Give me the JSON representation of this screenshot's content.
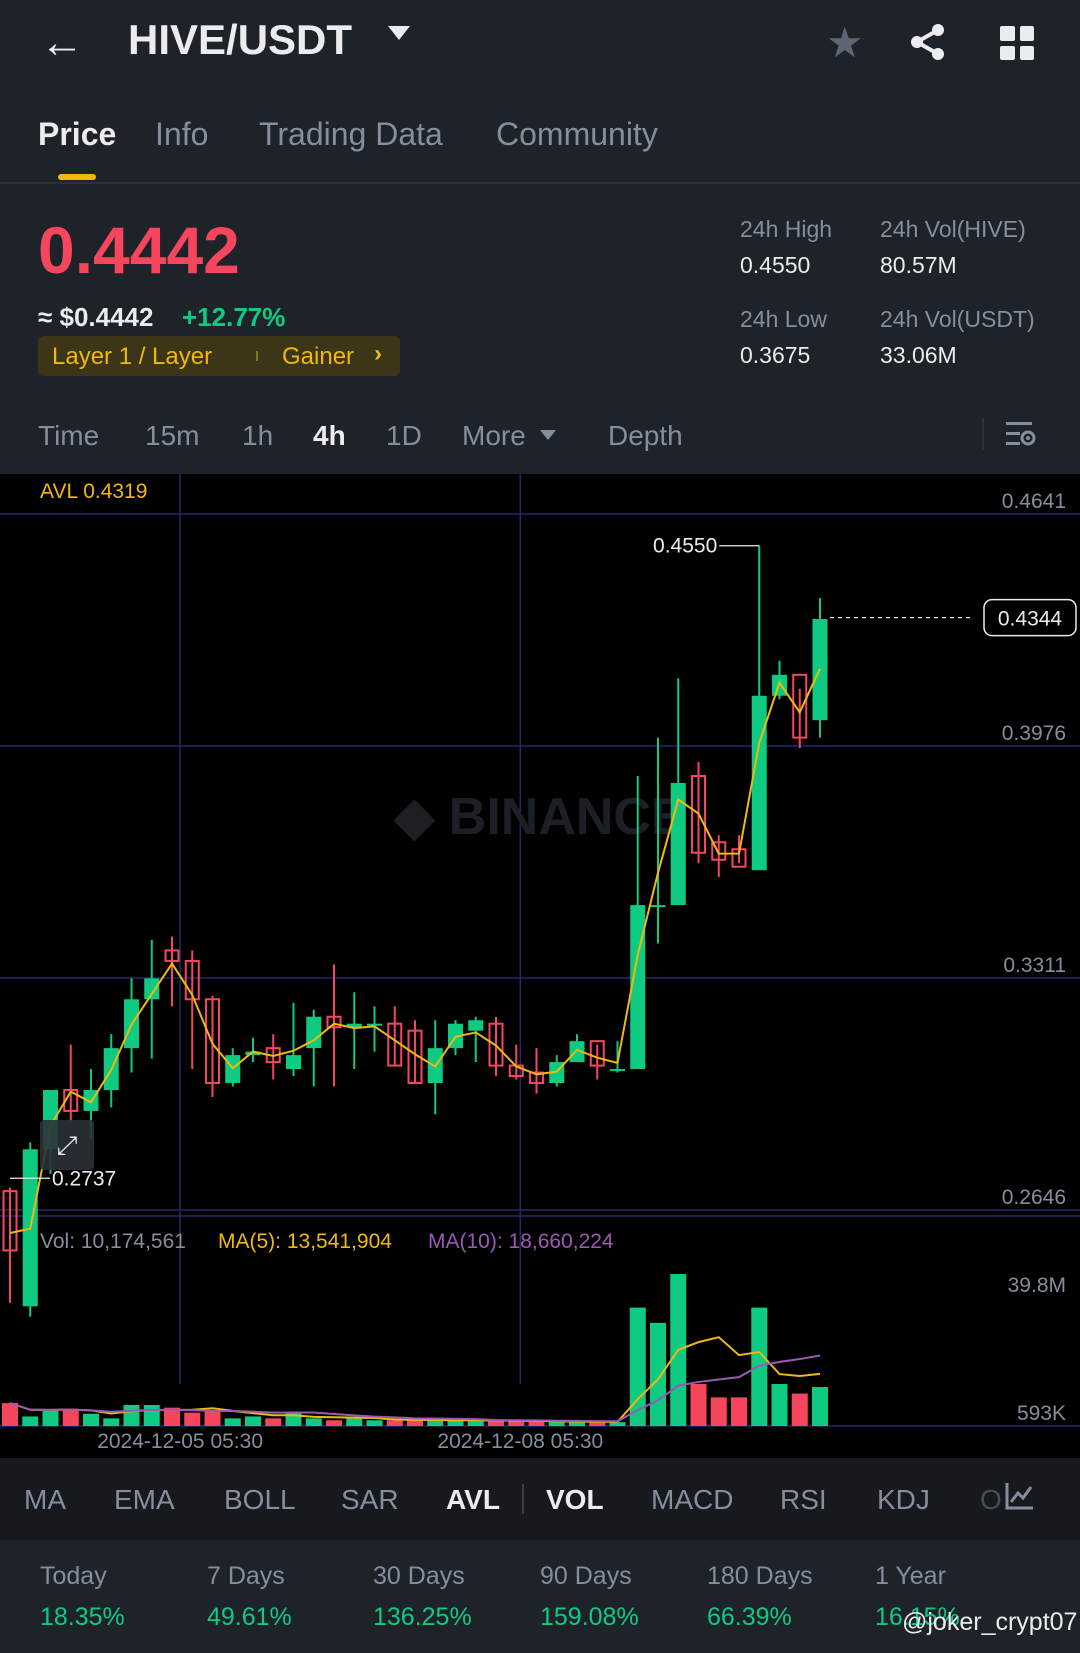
{
  "header": {
    "pair": "HIVE/USDT",
    "back_icon": "arrow-left-icon",
    "star_icon": "star-icon",
    "share_icon": "share-icon",
    "grid_icon": "grid-icon"
  },
  "tabs": [
    {
      "label": "Price",
      "active": true
    },
    {
      "label": "Info"
    },
    {
      "label": "Trading Data"
    },
    {
      "label": "Community"
    }
  ],
  "price": {
    "last": "0.4442",
    "usd": "≈ $0.4442",
    "change": "+12.77%",
    "tag_sector": "Layer 1 / Layer",
    "tag_status": "Gainer",
    "color_down": "#f6465d",
    "color_up": "#0ecb81",
    "accent": "#f0b90b"
  },
  "stats": {
    "high_label": "24h High",
    "high_value": "0.4550",
    "low_label": "24h Low",
    "low_value": "0.3675",
    "vol_base_label": "24h Vol(HIVE)",
    "vol_base_value": "80.57M",
    "vol_quote_label": "24h Vol(USDT)",
    "vol_quote_value": "33.06M"
  },
  "intervals": [
    {
      "label": "Time"
    },
    {
      "label": "15m"
    },
    {
      "label": "1h"
    },
    {
      "label": "4h",
      "active": true
    },
    {
      "label": "1D"
    },
    {
      "label": "More"
    },
    {
      "label": "Depth"
    }
  ],
  "chart_data": {
    "type": "candlestick",
    "avl_label": "AVL 0.4319",
    "y_ticks": [
      "0.4641",
      "0.3976",
      "0.3311",
      "0.2646"
    ],
    "ylim": [
      0.2646,
      0.4641
    ],
    "current_price": "0.4344",
    "high_marker": "0.4550",
    "low_marker": "0.2737",
    "x_labels": [
      "2024-12-05 05:30",
      "2024-12-08 05:30"
    ],
    "candles": [
      [
        0.27,
        0.253,
        0.271,
        0.238
      ],
      [
        0.237,
        0.282,
        0.284,
        0.234
      ],
      [
        0.282,
        0.299,
        0.299,
        0.275
      ],
      [
        0.299,
        0.293,
        0.312,
        0.29
      ],
      [
        0.293,
        0.299,
        0.305,
        0.285
      ],
      [
        0.299,
        0.311,
        0.315,
        0.294
      ],
      [
        0.311,
        0.325,
        0.331,
        0.304
      ],
      [
        0.325,
        0.331,
        0.342,
        0.308
      ],
      [
        0.339,
        0.336,
        0.343,
        0.323
      ],
      [
        0.336,
        0.325,
        0.339,
        0.305
      ],
      [
        0.325,
        0.301,
        0.326,
        0.297
      ],
      [
        0.301,
        0.309,
        0.311,
        0.3
      ],
      [
        0.309,
        0.31,
        0.314,
        0.307
      ],
      [
        0.311,
        0.307,
        0.315,
        0.302
      ],
      [
        0.305,
        0.309,
        0.324,
        0.303
      ],
      [
        0.311,
        0.32,
        0.322,
        0.3
      ],
      [
        0.32,
        0.317,
        0.335,
        0.3
      ],
      [
        0.317,
        0.318,
        0.327,
        0.305
      ],
      [
        0.318,
        0.318,
        0.323,
        0.31
      ],
      [
        0.318,
        0.306,
        0.323,
        0.306
      ],
      [
        0.316,
        0.301,
        0.319,
        0.301
      ],
      [
        0.301,
        0.311,
        0.319,
        0.292
      ],
      [
        0.311,
        0.318,
        0.319,
        0.309
      ],
      [
        0.316,
        0.319,
        0.32,
        0.307
      ],
      [
        0.318,
        0.306,
        0.32,
        0.303
      ],
      [
        0.306,
        0.303,
        0.312,
        0.302
      ],
      [
        0.304,
        0.301,
        0.311,
        0.298
      ],
      [
        0.301,
        0.307,
        0.309,
        0.3
      ],
      [
        0.307,
        0.313,
        0.315,
        0.307
      ],
      [
        0.313,
        0.306,
        0.312,
        0.302
      ],
      [
        0.305,
        0.305,
        0.313,
        0.304
      ],
      [
        0.305,
        0.352,
        0.389,
        0.305
      ],
      [
        0.352,
        0.352,
        0.4,
        0.341
      ],
      [
        0.352,
        0.387,
        0.417,
        0.373
      ],
      [
        0.389,
        0.367,
        0.393,
        0.364
      ],
      [
        0.37,
        0.365,
        0.372,
        0.36
      ],
      [
        0.368,
        0.363,
        0.372,
        0.364
      ],
      [
        0.362,
        0.412,
        0.455,
        0.365
      ],
      [
        0.412,
        0.418,
        0.422,
        0.411
      ],
      [
        0.418,
        0.4,
        0.414,
        0.397
      ],
      [
        0.405,
        0.434,
        0.44,
        0.4
      ]
    ],
    "avl_line_color": "#f0b90b",
    "volume": {
      "vol_label": "Vol: 10,174,561",
      "ma5_label": "MA(5): 13,541,904",
      "ma10_label": "MA(10): 18,660,224",
      "y_ticks": [
        "39.8M",
        "593K"
      ],
      "ylim": [
        0.593,
        39.8
      ],
      "values_millions": [
        6.0,
        2.5,
        4.2,
        4.5,
        3.2,
        2.0,
        5.5,
        5.5,
        4.8,
        3.5,
        4.0,
        2.0,
        2.5,
        2.0,
        3.5,
        2.0,
        1.5,
        2.0,
        1.5,
        1.5,
        1.5,
        1.5,
        1.5,
        1.5,
        1.2,
        1.2,
        1.2,
        1.2,
        1.0,
        1.0,
        1.0,
        31.0,
        27.0,
        39.8,
        11.0,
        7.5,
        7.5,
        31.0,
        11.0,
        8.5,
        10.2
      ],
      "ma5_color": "#f0b90b",
      "ma10_color": "#9b59b6"
    }
  },
  "indicators": [
    {
      "label": "MA"
    },
    {
      "label": "EMA"
    },
    {
      "label": "BOLL"
    },
    {
      "label": "SAR"
    },
    {
      "label": "AVL",
      "active": true
    },
    {
      "label": "VOL",
      "active": true
    },
    {
      "label": "MACD"
    },
    {
      "label": "RSI"
    },
    {
      "label": "KDJ"
    },
    {
      "label": "O"
    }
  ],
  "performance": [
    {
      "label": "Today",
      "value": "18.35%"
    },
    {
      "label": "7 Days",
      "value": "49.61%"
    },
    {
      "label": "30 Days",
      "value": "136.25%"
    },
    {
      "label": "90 Days",
      "value": "159.08%"
    },
    {
      "label": "180 Days",
      "value": "66.39%"
    },
    {
      "label": "1 Year",
      "value": "16.15%"
    }
  ],
  "watermark": "@joker_crypt07"
}
